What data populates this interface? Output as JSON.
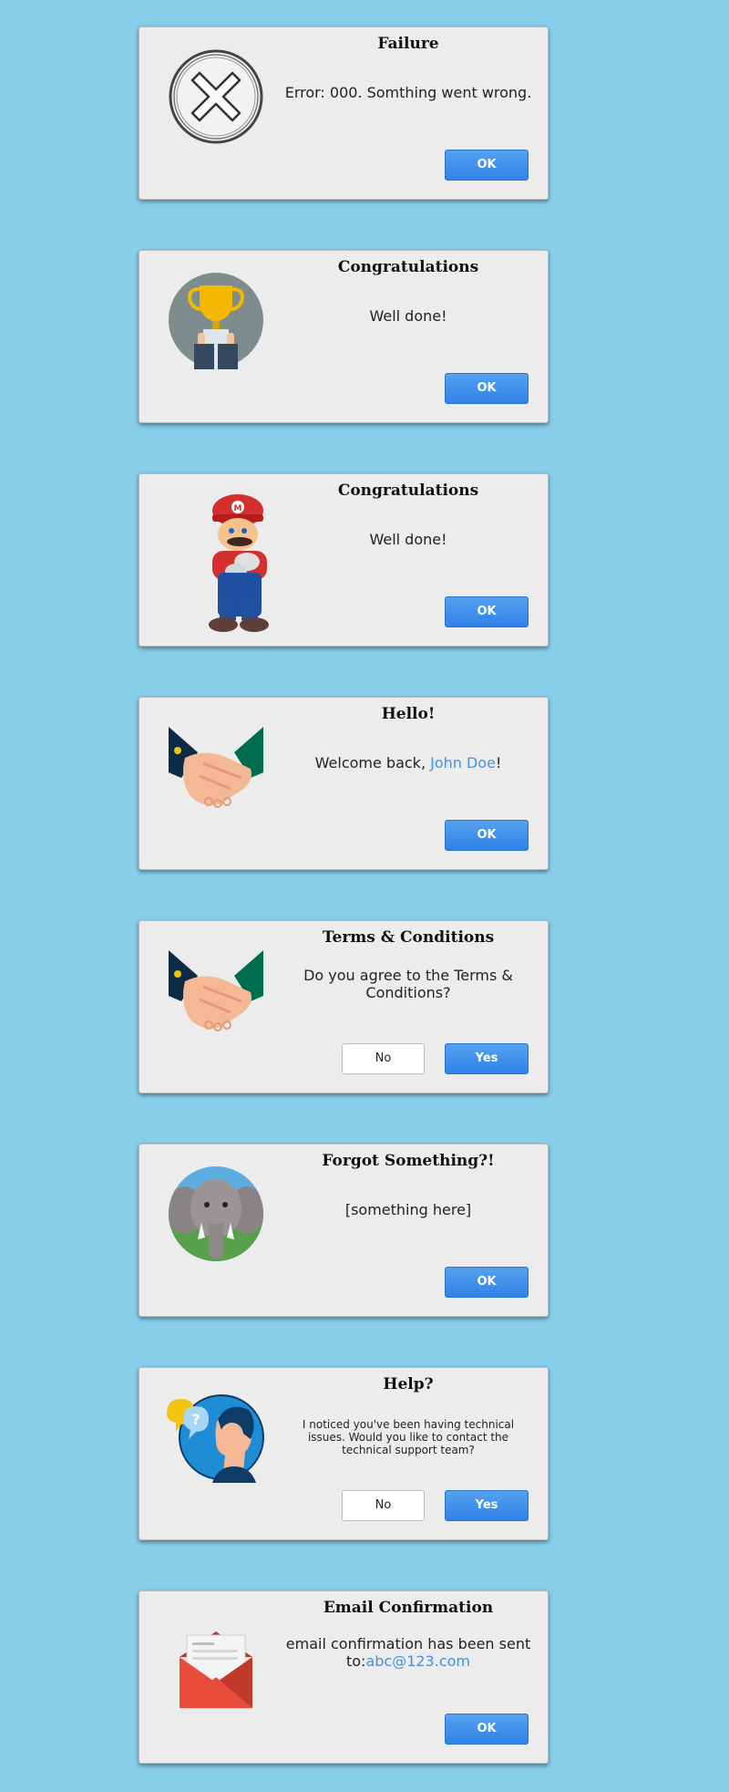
{
  "colors": {
    "background": "#87ceeb",
    "primary": "#3a8ee8",
    "highlight": "#4a90d9"
  },
  "dialogs": [
    {
      "icon": "error-x-icon",
      "title": "Failure",
      "message": "Error: 000. Somthing went wrong.",
      "ok": "OK"
    },
    {
      "icon": "trophy-icon",
      "title": "Congratulations",
      "message": "Well done!",
      "ok": "OK"
    },
    {
      "icon": "mario-character-icon",
      "title": "Congratulations",
      "message": "Well done!",
      "ok": "OK"
    },
    {
      "icon": "handshake-icon",
      "title": "Hello!",
      "message_prefix": "Welcome back, ",
      "user_name": "John Doe",
      "message_suffix": "!",
      "ok": "OK"
    },
    {
      "icon": "handshake-icon",
      "title": "Terms & Conditions",
      "message": "Do you agree to the Terms & Conditions?",
      "no": "No",
      "yes": "Yes"
    },
    {
      "icon": "elephant-icon",
      "title": "Forgot Something?!",
      "message": "[something here]",
      "ok": "OK"
    },
    {
      "icon": "support-person-icon",
      "title": "Help?",
      "message": "I noticed you've been having technical issues. Would you like to contact the technical support team?",
      "no": "No",
      "yes": "Yes"
    },
    {
      "icon": "envelope-icon",
      "title": "Email Confirmation",
      "message_prefix": "email confirmation has been sent to:",
      "email": "abc@123.com",
      "ok": "OK"
    }
  ]
}
